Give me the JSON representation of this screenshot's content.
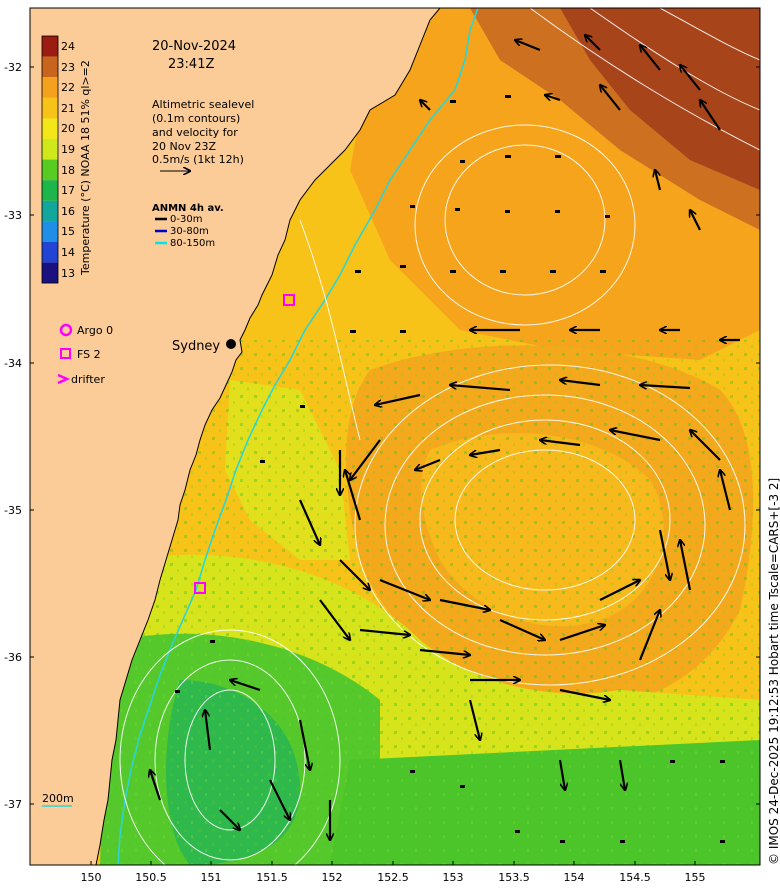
{
  "title": {
    "date": "20-Nov-2024",
    "time": "23:41Z"
  },
  "altimetry_note": [
    "Altimetric sealevel",
    "(0.1m contours)",
    "and velocity for",
    "20 Nov 23Z",
    "0.5m/s (1kt 12h)"
  ],
  "anmn": {
    "title": "ANMN 4h av.",
    "items": [
      {
        "label": "0-30m",
        "color": "#000000"
      },
      {
        "label": "30-80m",
        "color": "#0000cc"
      },
      {
        "label": "80-150m",
        "color": "#00e5e5"
      }
    ]
  },
  "legend": [
    {
      "label": "Argo 0",
      "symbol": "circle",
      "color": "#ff00ff"
    },
    {
      "label": "FS 2",
      "symbol": "square",
      "color": "#ff00ff"
    },
    {
      "label": "drifter",
      "symbol": "chevron",
      "color": "#ff00ff"
    }
  ],
  "colorbar": {
    "title": "Temperature (°C) NOAA 18 51% ql>=2",
    "ticks": [
      "24",
      "23",
      "22",
      "21",
      "20",
      "19",
      "18",
      "17",
      "16",
      "15",
      "14",
      "13"
    ],
    "colors": [
      "#9b1c10",
      "#c8641d",
      "#f4a11e",
      "#f7c318",
      "#f3e619",
      "#cfe81c",
      "#58cc22",
      "#1db64a",
      "#12a79c",
      "#1f8ee7",
      "#2244d4",
      "#1a1080"
    ]
  },
  "city": "Sydney",
  "depth_label": "200m",
  "x_ticks": [
    "150",
    "150.5",
    "151",
    "151.5",
    "152",
    "152.5",
    "153",
    "153.5",
    "154",
    "154.5",
    "155"
  ],
  "y_ticks": [
    "-32",
    "-33",
    "-34",
    "-35",
    "-36",
    "-37"
  ],
  "credit": "© IMOS 24-Dec-2025 19:12:53 Hobart time Tscale=CARS+[-3 2]",
  "colors": {
    "land": "#fbcb98",
    "sea_warm": "#f7b21a",
    "sea_hot": "#b4501a",
    "sea_mid": "#f0dc1e",
    "sea_cool": "#49c62b",
    "contour": "#ffffff",
    "isobath": "#2bd5d5",
    "marker": "#ff00ff"
  }
}
